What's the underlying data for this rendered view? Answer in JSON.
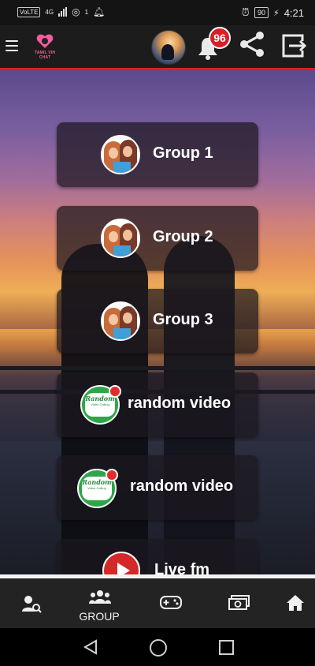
{
  "status_bar": {
    "volte": "VoLTE",
    "network": "4G",
    "notification_count": "1",
    "battery": "90",
    "time": "4:21"
  },
  "app_bar": {
    "logo_text": "TAMIL VIH CHAT",
    "notification_badge": "96",
    "accent_color": "#d62222"
  },
  "menu_cards": [
    {
      "label": "Group 1",
      "icon": "group-photo-icon"
    },
    {
      "label": "Group 2",
      "icon": "group-photo-icon"
    },
    {
      "label": "Group 3",
      "icon": "group-photo-icon"
    },
    {
      "label": "random video",
      "icon": "random-video-chat-icon",
      "icon_text": "Random",
      "icon_subtext": "Video Calling"
    },
    {
      "label": "random video",
      "icon": "random-video-chat-icon",
      "icon_text": "Random",
      "icon_subtext": "Video Calling"
    },
    {
      "label": "Live fm",
      "icon": "play-icon"
    }
  ],
  "bottom_nav": {
    "items": [
      {
        "icon": "user-search-icon",
        "label": ""
      },
      {
        "icon": "group-icon",
        "label": "GROUP"
      },
      {
        "icon": "gamepad-icon",
        "label": ""
      },
      {
        "icon": "money-icon",
        "label": ""
      },
      {
        "icon": "home-icon",
        "label": ""
      }
    ]
  }
}
